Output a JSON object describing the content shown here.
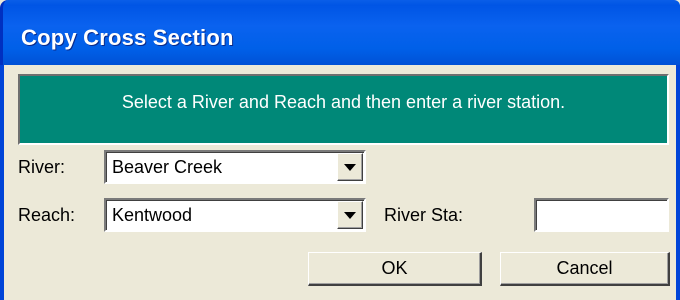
{
  "window": {
    "title": "Copy Cross Section"
  },
  "banner": {
    "text": "Select a River and Reach and then enter a river station."
  },
  "form": {
    "river_label": "River:",
    "river_value": "Beaver Creek",
    "reach_label": "Reach:",
    "reach_value": "Kentwood",
    "river_sta_label": "River Sta:",
    "river_sta_value": ""
  },
  "buttons": {
    "ok_label": "OK",
    "cancel_label": "Cancel"
  },
  "icons": {
    "dropdown": "chevron-down-icon"
  },
  "colors": {
    "titlebar": "#0a62ef",
    "banner": "#008878",
    "dialog_bg": "#ece9d8"
  }
}
